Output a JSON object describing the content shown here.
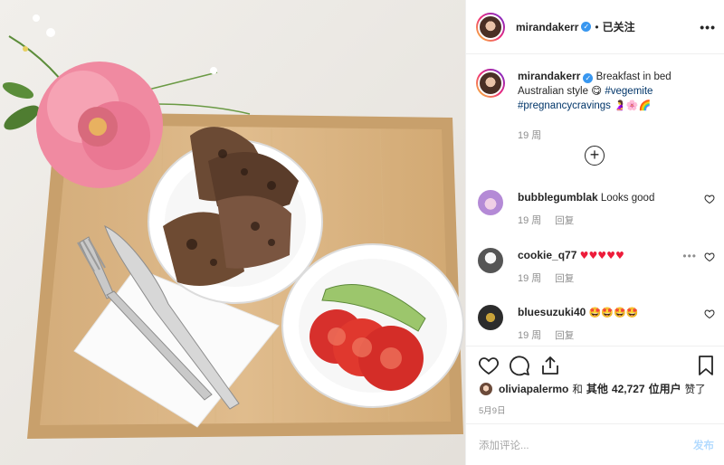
{
  "post": {
    "author": "mirandakerr",
    "follow_status": "已关注",
    "more_label": "•••",
    "verified_mark": "✓",
    "separator": "•",
    "caption": {
      "text": "Breakfast in bed Australian style 😋",
      "hashtag1": "#vegemite",
      "hashtag2": "#pregnancycravings",
      "emojis": "🤰🌸🌈",
      "time": "19 周"
    },
    "load_more_label": "+"
  },
  "comments": [
    {
      "user": "bubblegumblak",
      "text": "Looks good",
      "time": "19 周",
      "reply": "回复"
    },
    {
      "user": "cookie_q77",
      "text": "♥♥♥♥♥",
      "time": "19 周",
      "reply": "回复",
      "more": "•••"
    },
    {
      "user": "bluesuzuki40",
      "text": "🤩🤩🤩🤩",
      "time": "19 周",
      "reply": "回复"
    }
  ],
  "likes": {
    "user": "oliviapalermo",
    "and": "和",
    "others_label": "其他",
    "count": "42,727",
    "suffix": "位用户",
    "liked": "赞了"
  },
  "date": "5月9日",
  "add_comment": {
    "placeholder": "添加评论...",
    "post_label": "发布"
  },
  "colors": {
    "link": "#003569",
    "secondary": "#8e8e8e",
    "border": "#efefef",
    "verified": "#3897f0"
  }
}
